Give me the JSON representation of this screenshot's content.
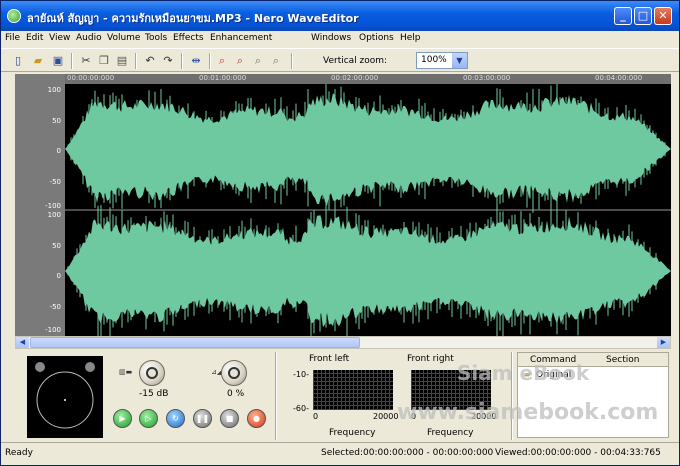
{
  "window": {
    "title": "ลายัณห์ สัญญา - ความรักเหมือนยาขม.MP3 - Nero WaveEditor",
    "minimize": "_",
    "maximize": "□",
    "close": "✕"
  },
  "menu": [
    "File",
    "Edit",
    "View",
    "Audio",
    "Volume",
    "Tools",
    "Effects",
    "Enhancement",
    "Windows",
    "Options",
    "Help"
  ],
  "toolbar": {
    "vertical_zoom_label": "Vertical zoom:",
    "zoom_value": "100%",
    "icons": [
      "new-file-icon",
      "open-folder-icon",
      "save-icon",
      "cut-icon",
      "copy-icon",
      "paste-icon",
      "undo-icon",
      "redo-icon",
      "fit-selection-icon",
      "zoom-in-icon",
      "zoom-out-icon",
      "zoom-vertical-in-icon",
      "zoom-vertical-out-icon"
    ]
  },
  "ruler": {
    "ticks": [
      "00:00:00:000",
      "00:01:00:000",
      "00:02:00:000",
      "00:03:00:000",
      "00:04:00:000"
    ]
  },
  "amplitude_labels": [
    "100",
    "50",
    "0",
    "-50",
    "-100"
  ],
  "waveform": {
    "color": "#6fc9a0",
    "background": "#000000",
    "channels": 2
  },
  "controls": {
    "volume_value": "-15 dB",
    "balance_value": "0 %",
    "playback_buttons": [
      "play-icon",
      "play-from-cursor-icon",
      "loop-icon",
      "pause-icon",
      "stop-icon",
      "record-icon"
    ]
  },
  "spectrum": {
    "left": {
      "title": "Front left",
      "y_top": "-10-",
      "y_bottom": "-60-",
      "x_min": "0",
      "x_max": "20000",
      "xlabel": "Frequency"
    },
    "right": {
      "title": "Front right",
      "x_min": "0",
      "x_max": "20000",
      "xlabel": "Frequency"
    }
  },
  "command_panel": {
    "col_command": "Command",
    "col_section": "Section",
    "items": [
      "Original"
    ]
  },
  "status": {
    "ready": "Ready",
    "selected": "Selected:00:00:00:000 - 00:00:00:000",
    "viewed": "Viewed:00:00:00:000 - 00:04:33:765"
  },
  "watermark": {
    "line1": "Siam eBook",
    "line2": "www.siamebook.com"
  }
}
